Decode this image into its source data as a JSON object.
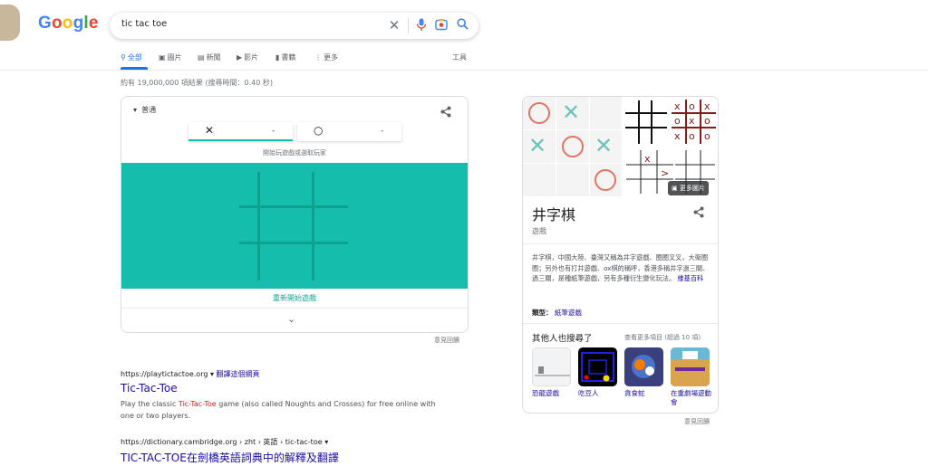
{
  "header": {
    "search_query": "tic tac toe",
    "logo": [
      "G",
      "o",
      "o",
      "g",
      "l",
      "e"
    ]
  },
  "tabs": [
    {
      "label": "全部",
      "icon": "search-icon"
    },
    {
      "label": "圖片",
      "icon": "image-icon"
    },
    {
      "label": "新聞",
      "icon": "news-icon"
    },
    {
      "label": "影片",
      "icon": "video-icon"
    },
    {
      "label": "書籍",
      "icon": "book-icon"
    },
    {
      "label": "更多",
      "icon": "more-vert-icon"
    }
  ],
  "tools_label": "工具",
  "result_stats": "約有 19,000,000 項結果 (搜尋時間：0.40 秒)",
  "game": {
    "mode_label": "普通",
    "player1": {
      "mark": "✕",
      "score": "-"
    },
    "player2": {
      "mark": "○",
      "score": "-"
    },
    "hint": "開始玩遊戲或選取玩家",
    "restart_label": "重新開始遊戲",
    "feedback": "意見回饋",
    "colors": {
      "board": "#14bdac",
      "grid": "#0da192"
    }
  },
  "results": [
    {
      "url": "https://playtictactoe.org",
      "translate": "翻譯這個網頁",
      "title": "Tic-Tac-Toe",
      "snippet_before": "Play the classic ",
      "snippet_em": "Tic-Tac-Toe",
      "snippet_after": " game (also called Noughts and Crosses) for free online with one or two players."
    },
    {
      "url": "https://dictionary.cambridge.org › zht › 英語 › tic-tac-toe",
      "title": "TIC-TAC-TOE在劍橋英語詞典中的解釋及翻譯"
    }
  ],
  "knowledge_panel": {
    "more_images": "更多圖片",
    "title": "井字棋",
    "subtitle": "遊戲",
    "description": "井字棋，中國大陸、臺灣又稱為井字遊戲、圈圈叉叉，大衛圈圈；另外也有打井遊戲、ox棋的稱呼，香港多稱井字過三關、過三關，是種紙筆遊戲，另有多種衍生變化玩法。",
    "wiki_link": "維基百科",
    "type_label": "類型：",
    "type_value": "紙筆遊戲",
    "also_search_label": "其他人也搜尋了",
    "see_more": "查看更多項目 (超過 10 項)",
    "related": [
      {
        "label": "恐龍遊戲"
      },
      {
        "label": "吃豆人"
      },
      {
        "label": "貪食蛇"
      },
      {
        "label": "在重劇場遊動會"
      }
    ],
    "feedback": "意見回饋"
  }
}
